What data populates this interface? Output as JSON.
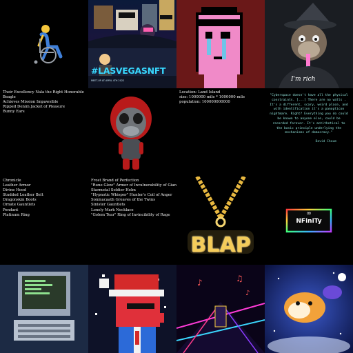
{
  "gallery": {
    "tiles": {
      "wheelchair": {
        "icon": "person-in-wheelchair-icon"
      },
      "lasvegas": {
        "hashtag": "#LASVEGASNFT",
        "subtitle": "MEET-UP AT APRIL 4TH 2022"
      },
      "punk": {
        "icon": "pink-pixel-punk-icon"
      },
      "ape": {
        "caption": "I'm rich",
        "icon": "wizard-ape-icon"
      },
      "nala_traits": {
        "lines": [
          "Their Excellency Nala the Right Honorable",
          "Beagle",
          "Achieves Mission Impawsible",
          "Ripped Denim Jacket of Pleasure",
          "Bunny Ears"
        ]
      },
      "monkey_figure": {
        "icon": "red-monkey-figure-icon"
      },
      "land": {
        "lines": [
          "Location: Land Island",
          "size: 1000000 mile * 1000000 mile",
          "population: 100000000000"
        ]
      },
      "quote": {
        "text": "\"Cyberspace doesn't have all the physical constraints. [...] There are no walls . It's a different, scary, weird place, and with identification it's a panopticon nightmare. Right? Everything you do could be known to anyone else, could be recorded forever. It's antithetical to the basic principle underlying the mechanisms of democracy.\"",
        "author": "David Chaum"
      },
      "loot_left": {
        "lines": [
          "Chronicle",
          "Leather Armor",
          "Divine Hood",
          "Studded Leather Belt",
          "Dragonskin Boots",
          "Ornate Gauntlets",
          "Pendant",
          "Platinum Ring"
        ]
      },
      "loot_right": {
        "lines": [
          "Frost Brand of Perfection",
          "\"Rune Glow\" Armor of Invulnerability of Giants",
          "Starmetal Soldier Helm",
          "\"Hypnotic Whisper\" Hunter's Coil of Anger",
          "Sonmacaath Greaves of the Twins",
          "Sinister Gauntlets",
          "Lonely Mark Necklace",
          "\"Golem Tear\" Ring of Invincibility of Rage"
        ]
      },
      "blap": {
        "text": "BLAP"
      },
      "nfinity": {
        "text": "NFiniTy",
        "symbol": "∞"
      },
      "computer": {
        "icon": "pixel-retro-computer-icon"
      },
      "santa": {
        "icon": "pixel-santa-creature-icon"
      },
      "neon": {
        "icon": "neon-music-hall-icon"
      },
      "doge": {
        "icon": "astronaut-doge-icon"
      }
    }
  },
  "colors": {
    "background": "#000000",
    "punk_pink": "#f08ac8",
    "neon_cyan": "#38d8ff",
    "gold": "#f4cc5a",
    "quote_text": "#8fe0d8"
  }
}
